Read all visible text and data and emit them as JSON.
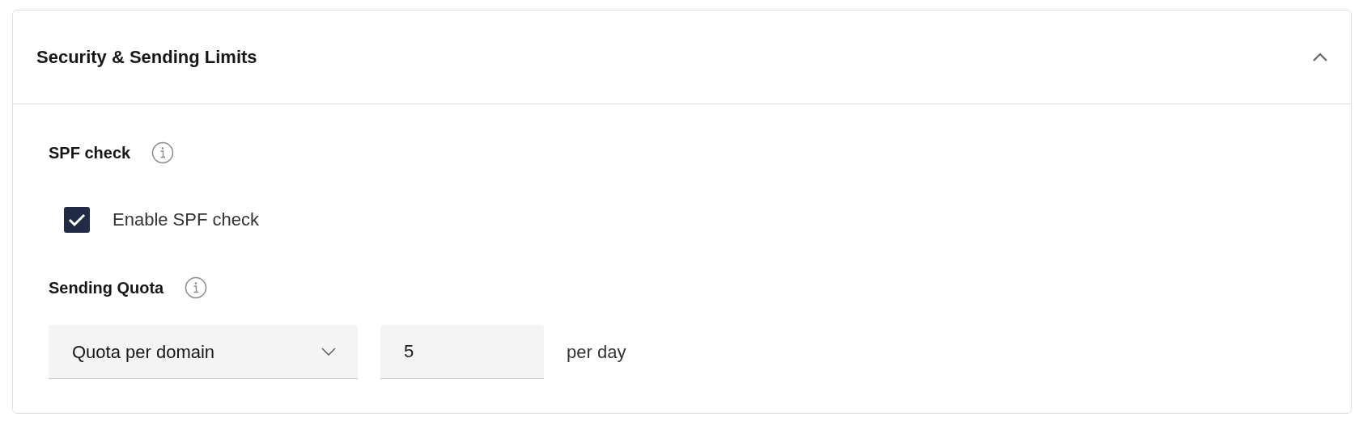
{
  "section": {
    "title": "Security & Sending Limits",
    "expanded": true,
    "spf": {
      "label": "SPF check",
      "checkbox": {
        "label": "Enable SPF check",
        "checked": true
      }
    },
    "quota": {
      "label": "Sending Quota",
      "select": {
        "value": "Quota per domain"
      },
      "input": {
        "value": "5"
      },
      "unit": "per day"
    }
  }
}
